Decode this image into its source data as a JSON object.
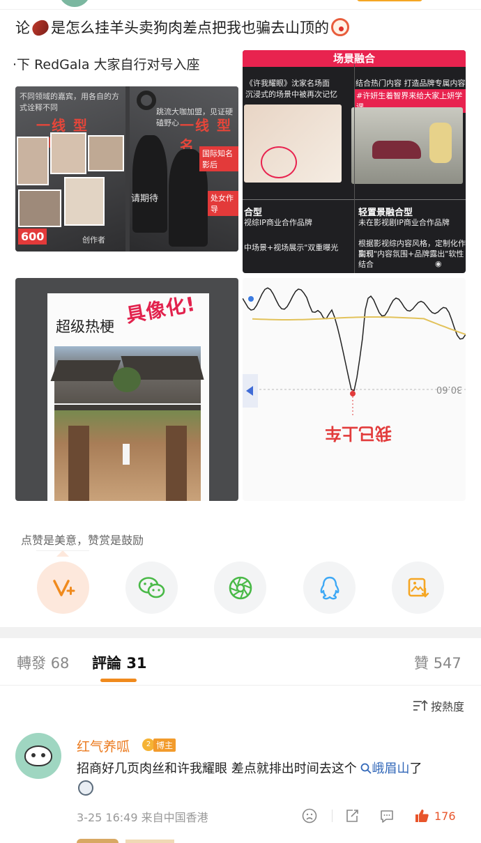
{
  "post": {
    "text_part1": "论",
    "text_part2": "是怎么挂羊头卖狗肉差点把我也骗去山顶的",
    "text_line2": "·下 RedGala 大家自行对号入座"
  },
  "images": {
    "img1": {
      "header_left": "一线 型CELE",
      "header_right": "一线 型名",
      "tag_intl": "国际知名影后",
      "tag_debut": "处女作导",
      "caption_left": "不同领域的嘉宾，用各自的方式诠释不同",
      "caption_right": "跳流大咖加盟，见证硬磕野心",
      "bottom_num": "600",
      "bottom_text": "创作者",
      "mystery": "请期待"
    },
    "img2": {
      "banner": "场景融合",
      "t1": "《许我耀眼》沈家名场面",
      "t2": "沉浸式的场景中被再次记忆",
      "t3": "结合热门内容 打造品牌专属内容场",
      "t4": "#许妍生着智界来给大家上妍学课",
      "h1": "合型",
      "h2": "轻置景融合型",
      "t5": "视综IP商业合作品牌",
      "t6": "未在影视剧IP商业合作品牌",
      "t7": "中场景+视场展示\"双重曝光",
      "t8": "根据影视综内容风格，定制化作副刊",
      "t9": "实现\"内容氛围+品牌露出\"软性结合"
    },
    "img3": {
      "title": "超级热梗",
      "red_text": "具像化!"
    },
    "img4": {
      "price": "30.60",
      "note": "我已上车"
    }
  },
  "reward": {
    "label": "点赞是美意，赞赏是鼓励"
  },
  "share_buttons": [
    {
      "name": "weibo-reward",
      "icon": "v-plus-icon"
    },
    {
      "name": "wechat",
      "icon": "wechat-icon"
    },
    {
      "name": "moments",
      "icon": "moments-icon"
    },
    {
      "name": "qq",
      "icon": "qq-icon"
    },
    {
      "name": "save-image",
      "icon": "save-image-icon"
    }
  ],
  "tabs": {
    "repost_label": "轉發",
    "repost_count": "68",
    "comment_label": "評論",
    "comment_count": "31",
    "like_label": "贊",
    "like_count": "547"
  },
  "sort": {
    "label": "按熱度"
  },
  "comment": {
    "username": "红气养呱",
    "badge": "博主",
    "badge_level": "2",
    "text_before": "招商好几页肉丝和许我耀眼 差点就排出时间去这个",
    "link": "峨眉山",
    "text_after": "了",
    "time": "3-25 16:49",
    "location": "来自中国香港",
    "likes": "176"
  },
  "colors": {
    "accent_orange": "#f08a1d",
    "like_red": "#e8552b",
    "link_blue": "#3167b8",
    "username_orange": "#eb7a1e",
    "wechat_green": "#49b947",
    "qq_blue": "#3da8f5"
  }
}
